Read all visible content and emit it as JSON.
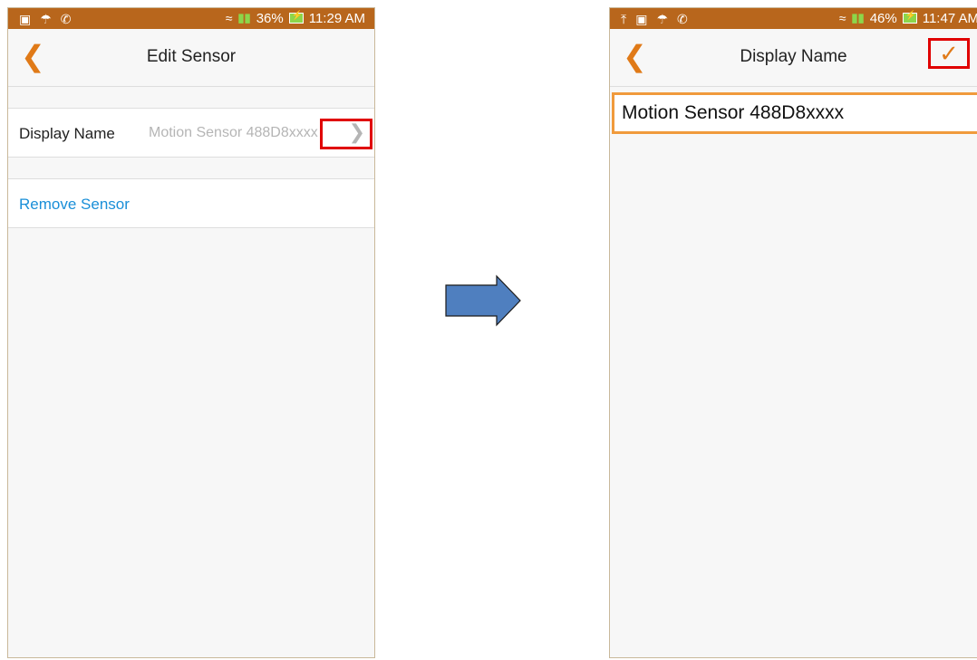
{
  "left_screen": {
    "status": {
      "battery": "36%",
      "time": "11:29 AM"
    },
    "title": "Edit Sensor",
    "display_name_label": "Display Name",
    "display_name_value": "Motion Sensor 488D8xxxx",
    "remove_sensor_label": "Remove Sensor"
  },
  "right_screen": {
    "status": {
      "battery": "46%",
      "time": "11:47 AM"
    },
    "title": "Display Name",
    "input_value": "Motion Sensor 488D8xxxx"
  },
  "colors": {
    "status_bar": "#b8661c",
    "accent_orange": "#e07a18",
    "link_blue": "#1a8fd8",
    "highlight_red": "#e00000",
    "arrow_blue": "#4f7fbf"
  },
  "icons": [
    "image-icon",
    "umbrella-icon",
    "phone-icon",
    "upload-icon",
    "wifi-icon",
    "signal-icon",
    "battery-icon",
    "back-chevron-icon",
    "chevron-right-icon",
    "checkmark-icon",
    "arrow-right-icon"
  ]
}
